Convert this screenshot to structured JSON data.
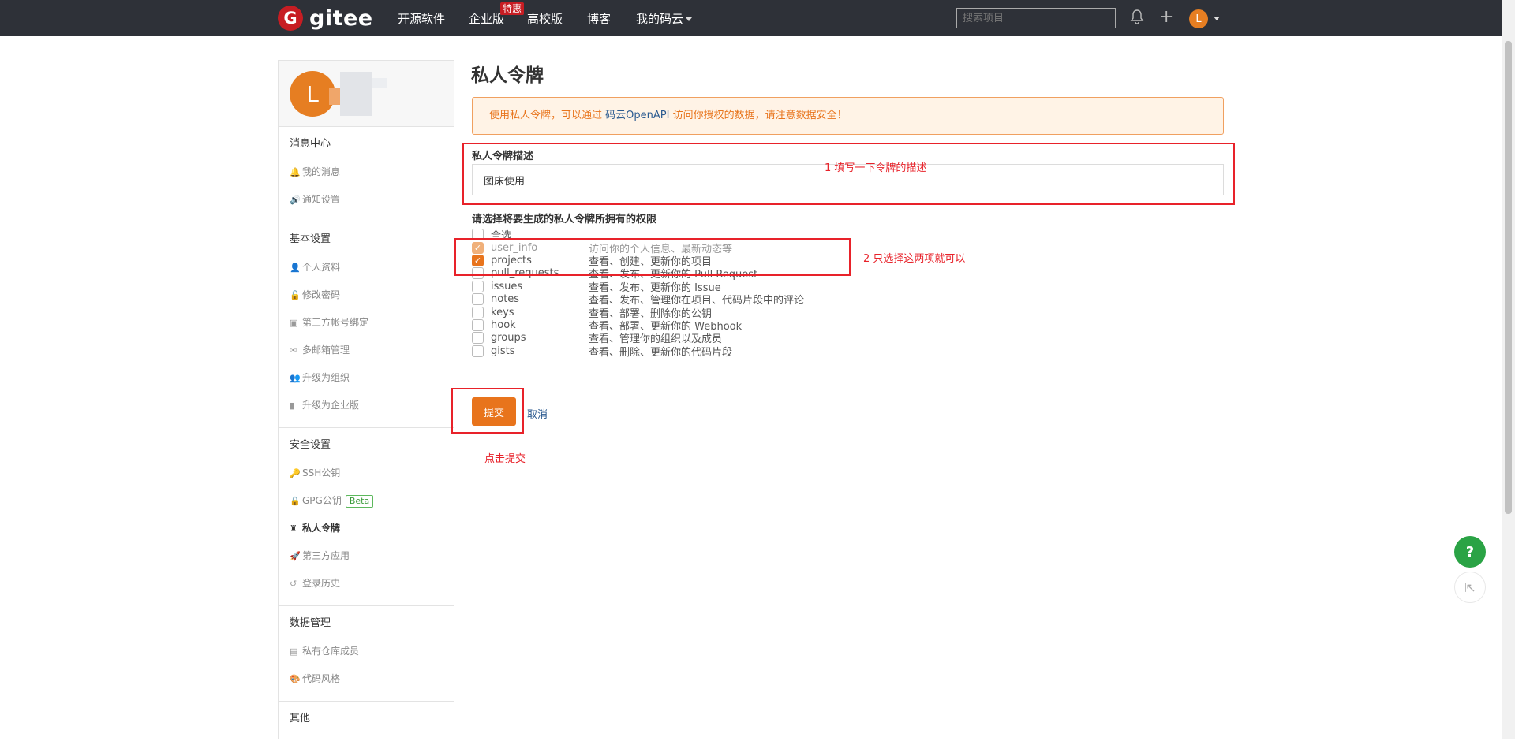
{
  "header": {
    "logo_mark": "G",
    "logo_text": "gitee",
    "nav": [
      "开源软件",
      "企业版",
      "高校版",
      "博客",
      "我的码云"
    ],
    "hot_badge": "特惠",
    "search_placeholder": "搜索项目",
    "plus_icon": "+",
    "bell_icon": "bell-icon",
    "avatar_letter": "L"
  },
  "sidebar": {
    "avatar_letter": "L",
    "groups": [
      {
        "title": "消息中心",
        "items": [
          {
            "icon": "bell-icon",
            "glyph": "🔔",
            "label": "我的消息"
          },
          {
            "icon": "speaker-icon",
            "glyph": "🔊",
            "label": "通知设置"
          }
        ]
      },
      {
        "title": "基本设置",
        "items": [
          {
            "icon": "user-icon",
            "glyph": "👤",
            "label": "个人资料"
          },
          {
            "icon": "unlock-icon",
            "glyph": "🔓",
            "label": "修改密码"
          },
          {
            "icon": "id-card-icon",
            "glyph": "▣",
            "label": "第三方帐号绑定"
          },
          {
            "icon": "envelope-icon",
            "glyph": "✉",
            "label": "多邮箱管理"
          },
          {
            "icon": "users-icon",
            "glyph": "👥",
            "label": "升级为组织"
          },
          {
            "icon": "building-icon",
            "glyph": "▮",
            "label": "升级为企业版"
          }
        ]
      },
      {
        "title": "安全设置",
        "items": [
          {
            "icon": "key-icon",
            "glyph": "🔑",
            "label": "SSH公钥"
          },
          {
            "icon": "lock-icon",
            "glyph": "🔒",
            "label": "GPG公钥",
            "badge": "Beta"
          },
          {
            "icon": "token-icon",
            "glyph": "♜",
            "label": "私人令牌",
            "active": true
          },
          {
            "icon": "rocket-icon",
            "glyph": "🚀",
            "label": "第三方应用"
          },
          {
            "icon": "history-icon",
            "glyph": "↺",
            "label": "登录历史"
          }
        ]
      },
      {
        "title": "数据管理",
        "items": [
          {
            "icon": "repo-icon",
            "glyph": "▤",
            "label": "私有仓库成员"
          },
          {
            "icon": "palette-icon",
            "glyph": "🎨",
            "label": "代码风格"
          }
        ]
      },
      {
        "title": "其他",
        "items": []
      }
    ]
  },
  "main": {
    "title": "私人令牌",
    "alert": {
      "before": "使用私人令牌，可以通过 ",
      "link": "码云OpenAPI",
      "after": " 访问你授权的数据，请注意数据安全！"
    },
    "desc_label": "私人令牌描述",
    "desc_value": "图床使用",
    "perm_label": "请选择将要生成的私人令牌所拥有的权限",
    "select_all": "全选",
    "permissions": [
      {
        "name": "user_info",
        "desc": "访问你的个人信息、最新动态等",
        "checked": true,
        "disabled": true
      },
      {
        "name": "projects",
        "desc": "查看、创建、更新你的项目",
        "checked": true,
        "disabled": false
      },
      {
        "name": "pull_requests",
        "desc": "查看、发布、更新你的 Pull Request",
        "checked": false,
        "disabled": false
      },
      {
        "name": "issues",
        "desc": "查看、发布、更新你的 Issue",
        "checked": false,
        "disabled": false
      },
      {
        "name": "notes",
        "desc": "查看、发布、管理你在项目、代码片段中的评论",
        "checked": false,
        "disabled": false
      },
      {
        "name": "keys",
        "desc": "查看、部署、删除你的公钥",
        "checked": false,
        "disabled": false
      },
      {
        "name": "hook",
        "desc": "查看、部署、更新你的 Webhook",
        "checked": false,
        "disabled": false
      },
      {
        "name": "groups",
        "desc": "查看、管理你的组织以及成员",
        "checked": false,
        "disabled": false
      },
      {
        "name": "gists",
        "desc": "查看、删除、更新你的代码片段",
        "checked": false,
        "disabled": false
      }
    ],
    "submit_label": "提交",
    "cancel_label": "取消"
  },
  "annotations": {
    "step1": "1 填写一下令牌的描述",
    "step2": "2 只选择这两项就可以",
    "step3": "点击提交"
  },
  "float": {
    "help_label": "?",
    "share_glyph": "⇱"
  },
  "colors": {
    "accent": "#e8741c",
    "annotation": "#e8222a",
    "nav_bg": "#2e3138",
    "help_green": "#2aa345"
  }
}
